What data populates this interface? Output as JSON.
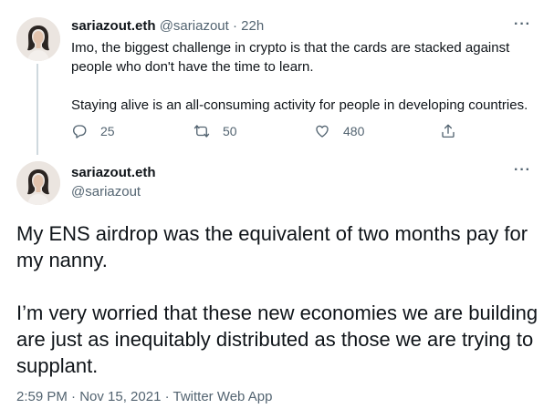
{
  "reply_tweet": {
    "author_name": "sariazout.eth",
    "author_handle": "@sariazout",
    "separator": "·",
    "time": "22h",
    "more_label": "···",
    "paragraphs": [
      "Imo, the biggest challenge in crypto is that the cards are stacked against people who don't have the time to learn.",
      "Staying alive is an all-consuming activity for people in developing countries."
    ],
    "actions": {
      "replies": "25",
      "retweets": "50",
      "likes": "480"
    }
  },
  "main_tweet": {
    "author_name": "sariazout.eth",
    "author_handle": "@sariazout",
    "more_label": "···",
    "paragraphs": [
      "My ENS airdrop was the equivalent of two months pay for my nanny.",
      "I’m very worried that these new economies we are building are just as inequitably distributed as those we are trying to supplant."
    ],
    "meta": "2:59 PM · Nov 15, 2021 · Twitter Web App"
  },
  "icons": {
    "reply": "reply-icon",
    "retweet": "retweet-icon",
    "like": "heart-icon",
    "share": "share-icon",
    "more": "more-icon"
  },
  "colors": {
    "text": "#0f1419",
    "secondary": "#536471",
    "thread_line": "#cfd9de",
    "background": "#ffffff"
  }
}
